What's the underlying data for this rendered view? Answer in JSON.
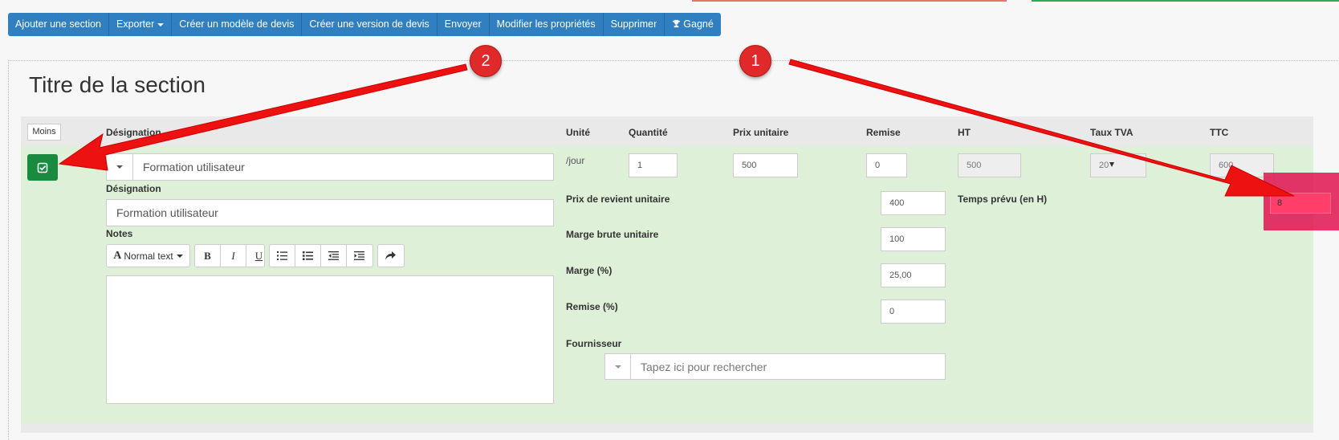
{
  "toolbar": {
    "add_section": "Ajouter une section",
    "export": "Exporter",
    "create_template": "Créer un modèle de devis",
    "create_version": "Créer une version de devis",
    "send": "Envoyer",
    "edit_properties": "Modifier les propriétés",
    "delete": "Supprimer",
    "won": "Gagné"
  },
  "section": {
    "title": "Titre de la section",
    "less_button": "Moins"
  },
  "columns": {
    "designation": "Désignation",
    "unit": "Unité",
    "quantity": "Quantité",
    "unit_price": "Prix unitaire",
    "discount": "Remise",
    "ht": "HT",
    "vat_rate": "Taux TVA",
    "ttc": "TTC"
  },
  "line": {
    "designation_value": "Formation utilisateur",
    "designation_label": "Désignation",
    "designation2_value": "Formation utilisateur",
    "notes_label": "Notes",
    "unit_value": "/jour",
    "quantity_value": "1",
    "unit_price_value": "500",
    "discount_value": "0",
    "ht_value": "500",
    "vat_value": "20",
    "ttc_value": "600",
    "cost_price_label": "Prix de revient unitaire",
    "cost_price_value": "400",
    "gross_margin_label": "Marge brute unitaire",
    "gross_margin_value": "100",
    "margin_pct_label": "Marge (%)",
    "margin_pct_value": "25,00",
    "discount_pct_label": "Remise (%)",
    "discount_pct_value": "0",
    "planned_time_label": "Temps prévu (en H)",
    "planned_time_value": "8",
    "supplier_label": "Fournisseur",
    "supplier_placeholder": "Tapez ici pour rechercher"
  },
  "editor": {
    "normal_text": "Normal text",
    "bold": "B",
    "italic": "I",
    "underline": "U"
  },
  "markers": {
    "one": "1",
    "two": "2"
  },
  "colors": {
    "toolbar": "#2f7fc1",
    "row_bg": "#dff0d8",
    "check_button": "#1a8a3e",
    "marker": "#e02a2a",
    "highlight": "#e11450"
  }
}
